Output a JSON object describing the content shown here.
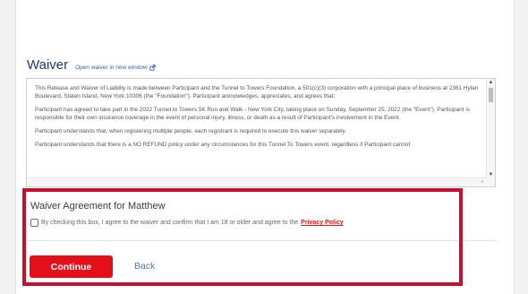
{
  "waiver": {
    "title": "Waiver",
    "open_link": "Open waiver in new window",
    "paragraphs": [
      "This Release and Waiver of Liability is made between Participant and the Tunnel to Towers Foundation, a 501(c)(3) corporation with a principal place of business at 2361 Hylan Boulevard, Staten Island, New York 10306 (the \"Foundation\").  Participant acknowledges, appreciates, and agrees that:",
      "Participant has agreed to take part in the 2022 Tunnel to Towers 5K Run and Walk - New York City, taking place on Sunday, September 25, 2022 (the \"Event\"). Participant is responsible for their own insurance coverage in the event of personal injury, illness, or death as a result of Participant's involvement in the Event.",
      "Participant understands that, when registering multiple people, each registrant is required to execute this waiver separately.",
      "Participant understands that there is a NO REFUND policy under any circumstances for this Tunnel To Towers event, regardless if Participant cannot"
    ]
  },
  "agreement": {
    "title": "Waiver Agreement for Matthew",
    "checkbox_text": "By checking this box, I agree to the waiver and confirm that I am 18 or older and agree to the",
    "privacy_link": "Privacy Policy",
    "checked": false
  },
  "actions": {
    "continue_label": "Continue",
    "back_label": "Back"
  },
  "colors": {
    "brand_red": "#e3101a",
    "title_navy": "#1d3a70",
    "link_blue": "#2d62c8",
    "highlight": "#c8102e"
  },
  "icons": {
    "external": "external-link-icon",
    "scroll_up": "arrow-up-icon",
    "scroll_down": "arrow-down-icon",
    "scroll_right": "arrow-right-icon"
  }
}
